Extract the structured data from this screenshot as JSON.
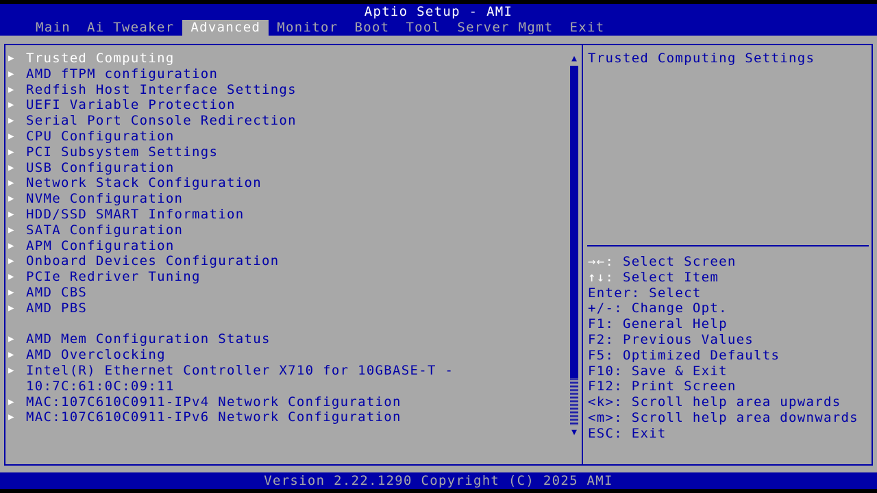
{
  "title": "Aptio Setup - AMI",
  "tabs": [
    {
      "label": "Main",
      "active": false
    },
    {
      "label": "Ai Tweaker",
      "active": false
    },
    {
      "label": "Advanced",
      "active": true
    },
    {
      "label": "Monitor",
      "active": false
    },
    {
      "label": "Boot",
      "active": false
    },
    {
      "label": "Tool",
      "active": false
    },
    {
      "label": "Server Mgmt",
      "active": false
    },
    {
      "label": "Exit",
      "active": false
    }
  ],
  "menu": {
    "items": [
      {
        "label": "Trusted Computing",
        "selected": true
      },
      {
        "label": "AMD fTPM configuration"
      },
      {
        "label": "Redfish Host Interface Settings"
      },
      {
        "label": "UEFI Variable Protection"
      },
      {
        "label": "Serial Port Console Redirection"
      },
      {
        "label": "CPU Configuration"
      },
      {
        "label": "PCI Subsystem Settings"
      },
      {
        "label": "USB Configuration"
      },
      {
        "label": "Network Stack Configuration"
      },
      {
        "label": "NVMe Configuration"
      },
      {
        "label": "HDD/SSD SMART Information"
      },
      {
        "label": "SATA Configuration"
      },
      {
        "label": "APM Configuration"
      },
      {
        "label": "Onboard Devices Configuration"
      },
      {
        "label": "PCIe Redriver Tuning"
      },
      {
        "label": "AMD CBS"
      },
      {
        "label": "AMD PBS"
      },
      {
        "label": "AMD Mem Configuration Status"
      },
      {
        "label": "AMD Overclocking"
      },
      {
        "label": "Intel(R) Ethernet Controller X710 for 10GBASE-T -",
        "continuation": "10:7C:61:0C:09:11"
      },
      {
        "label": "MAC:107C610C0911-IPv4 Network Configuration"
      },
      {
        "label": "MAC:107C610C0911-IPv6 Network Configuration"
      }
    ],
    "arrow_glyph": "▶"
  },
  "scrollbar": {
    "up": "▲",
    "down": "▼"
  },
  "help": {
    "text": "Trusted Computing Settings"
  },
  "keys": [
    {
      "key": "→←:",
      "desc": " Select Screen"
    },
    {
      "key": "↑↓:",
      "desc": " Select Item"
    },
    {
      "key": "Enter:",
      "desc": " Select"
    },
    {
      "key": "+/-:",
      "desc": " Change Opt."
    },
    {
      "key": "F1:",
      "desc": " General Help"
    },
    {
      "key": "F2:",
      "desc": " Previous Values"
    },
    {
      "key": "F5:",
      "desc": " Optimized Defaults"
    },
    {
      "key": "F10:",
      "desc": " Save & Exit"
    },
    {
      "key": "F12:",
      "desc": " Print Screen"
    },
    {
      "key": "<k>:",
      "desc": " Scroll help area upwards"
    },
    {
      "key": "<m>:",
      "desc": " Scroll help area downwards"
    },
    {
      "key": "ESC:",
      "desc": " Exit"
    }
  ],
  "footer": "Version 2.22.1290 Copyright (C) 2025 AMI",
  "colors": {
    "blue": "#0000a8",
    "gray": "#a8a8a8",
    "white": "#ffffff"
  }
}
